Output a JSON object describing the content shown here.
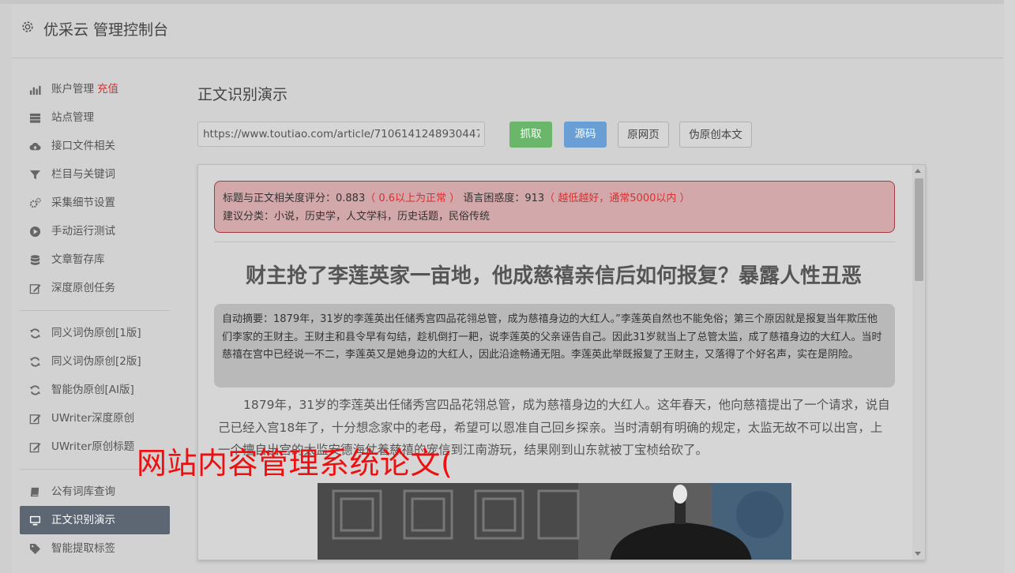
{
  "app": {
    "title": "优采云 管理控制台"
  },
  "sidebar": {
    "group1": [
      {
        "label": "账户管理",
        "badge": "充值",
        "icon": "bar-chart-icon"
      },
      {
        "label": "站点管理",
        "icon": "server-icon"
      },
      {
        "label": "接口文件相关",
        "icon": "cloud-upload-icon"
      },
      {
        "label": "栏目与关键词",
        "icon": "filter-icon"
      },
      {
        "label": "采集细节设置",
        "icon": "cogs-icon"
      },
      {
        "label": "手动运行测试",
        "icon": "play-circle-icon"
      },
      {
        "label": "文章暂存库",
        "icon": "database-icon"
      },
      {
        "label": "深度原创任务",
        "icon": "edit-icon"
      }
    ],
    "group2": [
      {
        "label": "同义词伪原创[1版]",
        "icon": "refresh-icon"
      },
      {
        "label": "同义词伪原创[2版]",
        "icon": "refresh-icon"
      },
      {
        "label": "智能伪原创[AI版]",
        "icon": "refresh-icon"
      },
      {
        "label": "UWriter深度原创",
        "icon": "edit-icon"
      },
      {
        "label": "UWriter原创标题",
        "icon": "edit-icon"
      }
    ],
    "group3": [
      {
        "label": "公有词库查询",
        "icon": "book-icon"
      },
      {
        "label": "正文识别演示",
        "icon": "monitor-icon",
        "active": true
      },
      {
        "label": "智能提取标签",
        "icon": "tag-icon"
      }
    ]
  },
  "main": {
    "title": "正文识别演示",
    "url_value": "https://www.toutiao.com/article/7106141248930447",
    "buttons": {
      "fetch": "抓取",
      "source": "源码",
      "original": "原网页",
      "rewrite": "伪原创本文"
    }
  },
  "result": {
    "score_label": "标题与正文相关度评分：0.883",
    "score_note": "（ 0.6以上为正常 ）",
    "perplexity_label": "语言困惑度：913",
    "perplexity_note": "（ 越低越好，通常5000以内 ）",
    "category": "建议分类：小说，历史学，人文学科，历史话题，民俗传统",
    "article_title": "财主抢了李莲英家一亩地，他成慈禧亲信后如何报复？暴露人性丑恶",
    "summary": "自动摘要：1879年，31岁的李莲英出任储秀宫四品花翎总管，成为慈禧身边的大红人。”李莲英自然也不能免俗；第三个原因就是报复当年欺压他们李家的王财主。王财主和县令早有勾结，趁机倒打一耙，说李莲英的父亲诬告自己。因此31岁就当上了总管太监，成了慈禧身边的大红人。当时慈禧在宫中已经说一不二，李莲英又是她身边的大红人，因此沿途畅通无阻。李莲英此举既报复了王财主，又落得了个好名声，实在是阴险。",
    "body": "1879年，31岁的李莲英出任储秀宫四品花翎总管，成为慈禧身边的大红人。这年春天，他向慈禧提出了一个请求，说自己已经入宫18年了，十分想念家中的老母，希望可以恩准自己回乡探亲。当时清朝有明确的规定，太监无故不可以出宫，上一个擅自出宫的太监安德海仗着慈禧的宠信到江南游玩，结果刚到山东就被丁宝桢给砍了。"
  },
  "watermark": "网站内容管理系统论文("
}
